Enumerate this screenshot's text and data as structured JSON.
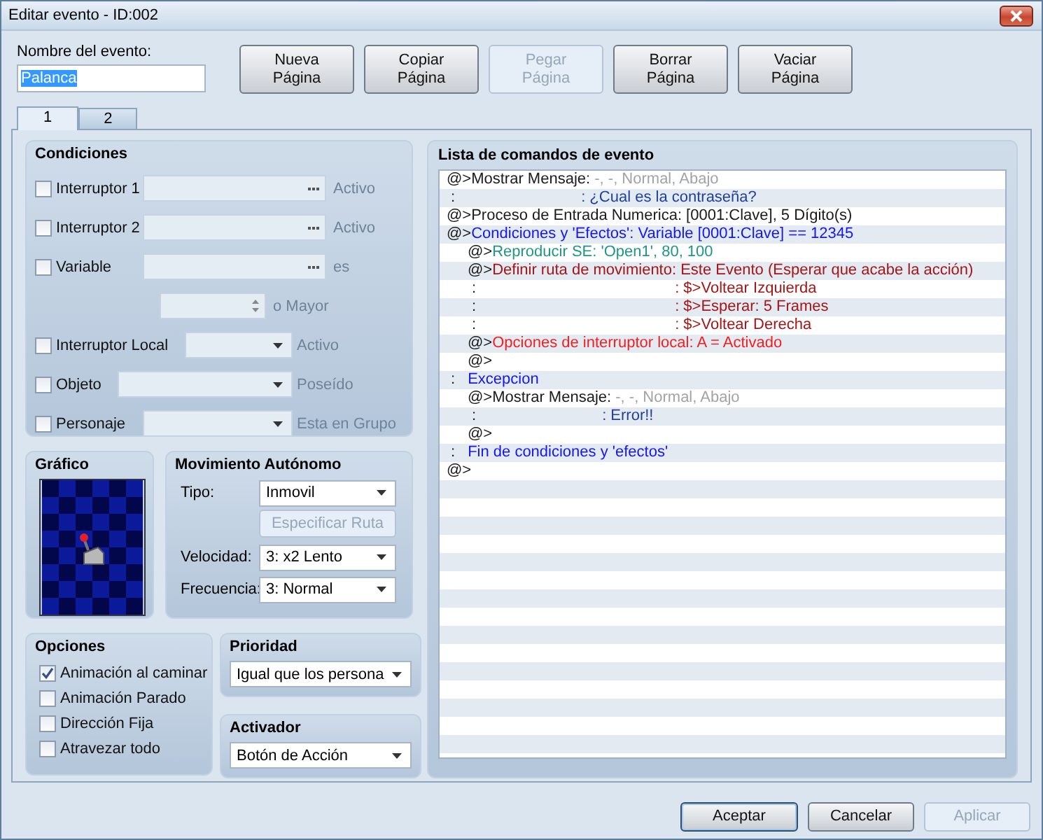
{
  "window": {
    "title": "Editar evento - ID:002"
  },
  "event_name": {
    "label": "Nombre del evento:",
    "value": "Palanca",
    "selected": true
  },
  "page_buttons": [
    {
      "label": "Nueva\nPágina",
      "disabled": false
    },
    {
      "label": "Copiar\nPágina",
      "disabled": false
    },
    {
      "label": "Pegar\nPágina",
      "disabled": true
    },
    {
      "label": "Borrar\nPágina",
      "disabled": false
    },
    {
      "label": "Vaciar\nPágina",
      "disabled": false
    }
  ],
  "tabs": [
    {
      "label": "1",
      "selected": true
    },
    {
      "label": "2",
      "selected": false
    }
  ],
  "conditions": {
    "title": "Condiciones",
    "items": [
      {
        "kind": "picker",
        "label": "Interruptor 1",
        "checked": false,
        "suffix": "Activo"
      },
      {
        "kind": "picker",
        "label": "Interruptor 2",
        "checked": false,
        "suffix": "Activo"
      },
      {
        "kind": "picker",
        "label": "Variable",
        "checked": false,
        "suffix": "es"
      },
      {
        "kind": "spinner",
        "disabled": true,
        "suffix": "o Mayor"
      },
      {
        "kind": "dropdown",
        "label": "Interruptor Local",
        "checked": false,
        "suffix": "Activo"
      },
      {
        "kind": "dropdown",
        "label": "Objeto",
        "checked": false,
        "suffix": "Poseído"
      },
      {
        "kind": "dropdown",
        "label": "Personaje",
        "checked": false,
        "suffix": "Esta en Grupo"
      }
    ]
  },
  "graphic": {
    "title": "Gráfico"
  },
  "movement": {
    "title": "Movimiento Autónomo",
    "rows": [
      {
        "kind": "dropdown",
        "label": "Tipo:",
        "value": "Inmovil"
      },
      {
        "kind": "button",
        "label": "Especificar Ruta",
        "disabled": true
      },
      {
        "kind": "dropdown",
        "label": "Velocidad:",
        "value": "3: x2 Lento"
      },
      {
        "kind": "dropdown",
        "label": "Frecuencia:",
        "value": "3: Normal"
      }
    ]
  },
  "options": {
    "title": "Opciones",
    "items": [
      {
        "label": "Animación al caminar",
        "checked": true
      },
      {
        "label": "Animación Parado",
        "checked": false
      },
      {
        "label": "Dirección Fija",
        "checked": false
      },
      {
        "label": "Atravezar todo",
        "checked": false
      }
    ]
  },
  "priority": {
    "title": "Prioridad",
    "value": "Igual que los persona"
  },
  "trigger": {
    "title": "Activador",
    "value": "Botón de Acción"
  },
  "command_list": {
    "title": "Lista de comandos de evento",
    "rows": [
      {
        "kind": "command",
        "segments": [
          {
            "text": "@>Mostrar Mensaje: ",
            "kind": "plain"
          },
          {
            "text": "-, -, Normal, Abajo",
            "kind": "muted"
          }
        ]
      },
      {
        "kind": "message-text",
        "segments": [
          {
            "text": ":",
            "kind": "plain"
          },
          {
            "text": ": ¿Cual es la contraseña?",
            "kind": "message"
          }
        ]
      },
      {
        "kind": "command",
        "segments": [
          {
            "text": "@>Proceso de Entrada Numerica: [0001:Clave], 5 Dígito(s)",
            "kind": "plain"
          }
        ]
      },
      {
        "kind": "command",
        "segments": [
          {
            "text": "@>",
            "kind": "plain"
          },
          {
            "text": "Condiciones y 'Efectos': Variable [0001:Clave] == 12345",
            "kind": "condition"
          }
        ],
        "children": [
          {
            "kind": "command",
            "segments": [
              {
                "text": "@>",
                "kind": "plain"
              },
              {
                "text": "Reproducir SE: 'Open1', 80, 100",
                "kind": "sound"
              }
            ]
          },
          {
            "kind": "command",
            "segments": [
              {
                "text": "@>",
                "kind": "plain"
              },
              {
                "text": "Definir ruta de movimiento: Este Evento (Esperar que acabe la acción)",
                "kind": "route"
              }
            ]
          },
          {
            "kind": "route-step",
            "segments": [
              {
                "text": ":",
                "kind": "plain"
              },
              {
                "text": ": $>Voltear Izquierda",
                "kind": "route"
              }
            ]
          },
          {
            "kind": "route-step",
            "segments": [
              {
                "text": ":",
                "kind": "plain"
              },
              {
                "text": ": $>Esperar: 5 Frames",
                "kind": "route"
              }
            ]
          },
          {
            "kind": "route-step",
            "segments": [
              {
                "text": ":",
                "kind": "plain"
              },
              {
                "text": ": $>Voltear Derecha",
                "kind": "route"
              }
            ]
          },
          {
            "kind": "command",
            "segments": [
              {
                "text": "@>",
                "kind": "plain"
              },
              {
                "text": "Opciones de interruptor local: A = Activado",
                "kind": "switch"
              }
            ]
          },
          {
            "kind": "command",
            "segments": [
              {
                "text": "@>",
                "kind": "plain"
              }
            ]
          }
        ]
      },
      {
        "kind": "branch",
        "segments": [
          {
            "text": ":",
            "kind": "plain"
          },
          {
            "text": "Excepcion",
            "kind": "condition"
          }
        ],
        "children": [
          {
            "kind": "command",
            "segments": [
              {
                "text": "@>Mostrar Mensaje: ",
                "kind": "plain"
              },
              {
                "text": "-, -, Normal, Abajo",
                "kind": "muted"
              }
            ]
          },
          {
            "kind": "message-text",
            "segments": [
              {
                "text": ":",
                "kind": "plain"
              },
              {
                "text": ": Error!!",
                "kind": "message"
              }
            ]
          },
          {
            "kind": "command",
            "segments": [
              {
                "text": "@>",
                "kind": "plain"
              }
            ]
          }
        ]
      },
      {
        "kind": "branch",
        "segments": [
          {
            "text": ":",
            "kind": "plain"
          },
          {
            "text": "Fin de condiciones y 'efectos'",
            "kind": "condition"
          }
        ]
      },
      {
        "kind": "command",
        "segments": [
          {
            "text": "@>",
            "kind": "plain"
          }
        ]
      }
    ]
  },
  "dialog_buttons": [
    {
      "label": "Aceptar",
      "disabled": false,
      "default": true
    },
    {
      "label": "Cancelar",
      "disabled": false,
      "default": false
    },
    {
      "label": "Aplicar",
      "disabled": true,
      "default": false
    }
  ]
}
